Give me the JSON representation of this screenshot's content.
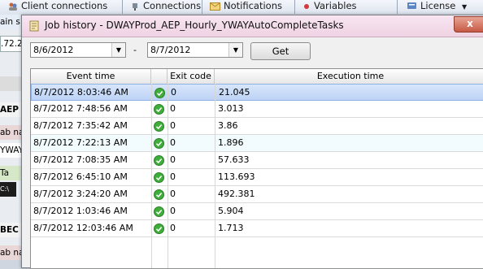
{
  "app_toolbar": {
    "items": [
      {
        "label": "Client connections",
        "icon": "people-icon"
      },
      {
        "label": "Connections",
        "icon": "plug-icon"
      },
      {
        "label": "Notifications",
        "icon": "envelope-icon"
      },
      {
        "label": "Variables",
        "icon": "dot-icon"
      },
      {
        "label": "License",
        "icon": "badge-icon"
      }
    ]
  },
  "background_left": {
    "fragments": [
      "ain s",
      ".72.2",
      "AEP",
      "ab na",
      "YWAY",
      "Ta",
      "BEC",
      "ab na"
    ]
  },
  "dialog": {
    "title": "Job history - DWAYProd_AEP_Hourly_YWAYAutoCompleteTasks",
    "close_label": "x",
    "from_date": "8/6/2012",
    "separator": "-",
    "to_date": "8/7/2012",
    "get_label": "Get",
    "columns": {
      "event_time": "Event time",
      "status": "",
      "exit_code": "Exit code",
      "execution_time": "Execution time"
    },
    "rows": [
      {
        "event_time": "8/7/2012 8:03:46 AM",
        "exit_code": "0",
        "execution_time": "21.045",
        "status": "success"
      },
      {
        "event_time": "8/7/2012 7:48:56 AM",
        "exit_code": "0",
        "execution_time": "3.013",
        "status": "success"
      },
      {
        "event_time": "8/7/2012 7:35:42 AM",
        "exit_code": "0",
        "execution_time": "3.86",
        "status": "success"
      },
      {
        "event_time": "8/7/2012 7:22:13 AM",
        "exit_code": "0",
        "execution_time": "1.896",
        "status": "success"
      },
      {
        "event_time": "8/7/2012 7:08:35 AM",
        "exit_code": "0",
        "execution_time": "57.633",
        "status": "success"
      },
      {
        "event_time": "8/7/2012 6:45:10 AM",
        "exit_code": "0",
        "execution_time": "113.693",
        "status": "success"
      },
      {
        "event_time": "8/7/2012 3:24:20 AM",
        "exit_code": "0",
        "execution_time": "492.381",
        "status": "success"
      },
      {
        "event_time": "8/7/2012 1:03:46 AM",
        "exit_code": "0",
        "execution_time": "5.904",
        "status": "success"
      },
      {
        "event_time": "8/7/2012 12:03:46 AM",
        "exit_code": "0",
        "execution_time": "1.713",
        "status": "success"
      }
    ],
    "selected_row": 0
  },
  "colors": {
    "success": "#3fae3a",
    "selection": "#bdd3f5",
    "title_bar": "#efd2e3"
  }
}
